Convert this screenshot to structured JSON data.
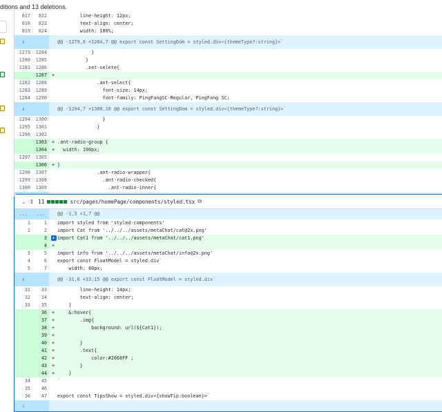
{
  "header": {
    "summary": "ditions and 13 deletions."
  },
  "file1": {
    "rows": [
      {
        "t": "ctx",
        "o": "817",
        "n": "822",
        "c": "        line-height: 12px;"
      },
      {
        "t": "ctx",
        "o": "818",
        "n": "823",
        "c": "        text-align: center;"
      },
      {
        "t": "ctx",
        "o": "819",
        "n": "824",
        "c": "        width: 100%;"
      },
      {
        "t": "hunk",
        "c": "@@ -1279,6 +1284,7 @@ export const SettingDom = styled.div<{themeType?:string}>`"
      },
      {
        "t": "ctx",
        "o": "1279",
        "n": "1284",
        "c": "            }"
      },
      {
        "t": "ctx",
        "o": "1280",
        "n": "1285",
        "c": "          }"
      },
      {
        "t": "ctx",
        "o": "1281",
        "n": "1286",
        "c": "          .set-selete{"
      },
      {
        "t": "add",
        "o": "",
        "n": "1287",
        "c": ""
      },
      {
        "t": "ctx",
        "o": "1282",
        "n": "1288",
        "c": "              .ant-select{"
      },
      {
        "t": "ctx",
        "o": "1283",
        "n": "1289",
        "c": "                font-size: 14px;"
      },
      {
        "t": "ctx",
        "o": "1284",
        "n": "1290",
        "c": "                font-family: PingFangSC-Regular, PingFang SC;"
      },
      {
        "t": "hunk",
        "c": "@@ -1294,7 +1300,10 @@ export const SettingDom = styled.div<{themeType?:string}>`"
      },
      {
        "t": "ctx",
        "o": "1294",
        "n": "1300",
        "c": "                }"
      },
      {
        "t": "ctx",
        "o": "1295",
        "n": "1301",
        "c": "              }"
      },
      {
        "t": "ctx",
        "o": "1296",
        "n": "1302",
        "c": ""
      },
      {
        "t": "add",
        "o": "",
        "n": "1303",
        "c": ".ant-radio-group {"
      },
      {
        "t": "add",
        "o": "",
        "n": "1304",
        "c": "  width: 190px;"
      },
      {
        "t": "ctx",
        "o": "1297",
        "n": "1305",
        "c": ""
      },
      {
        "t": "add",
        "o": "",
        "n": "1306",
        "c": "}"
      },
      {
        "t": "ctx",
        "o": "1298",
        "n": "1307",
        "c": "              .ant-radio-wrapper{"
      },
      {
        "t": "ctx",
        "o": "1299",
        "n": "1308",
        "c": "                .ant-radio-checked{"
      },
      {
        "t": "ctx",
        "o": "1300",
        "n": "1309",
        "c": "                  .ant-radio-inner{"
      }
    ]
  },
  "file2": {
    "count": "11",
    "path": "src/pages/homePage/components/styled.tsx",
    "dots_left": "...",
    "dots_right": "...",
    "first_hunk": "@@ -1,5 +1,7 @@",
    "rows": [
      {
        "t": "ctx",
        "o": "1",
        "n": "1",
        "c": "import styled from 'styled-components'"
      },
      {
        "t": "ctx",
        "o": "2",
        "n": "2",
        "c": "import Cat from '../../../assets/metaChat/cat@2x.png'"
      },
      {
        "t": "add",
        "o": "",
        "n": "3",
        "c": "import Cat1 from '../../../assets/metaChat/cat1.png'",
        "btn": true
      },
      {
        "t": "add",
        "o": "",
        "n": "4",
        "c": ""
      },
      {
        "t": "ctx",
        "o": "3",
        "n": "5",
        "c": "import info from '../../../assets/metaChat/info@2x.png'"
      },
      {
        "t": "ctx",
        "o": "4",
        "n": "6",
        "c": "export const FloatModel = styled.div`"
      },
      {
        "t": "ctx",
        "o": "5",
        "n": "7",
        "c": "    width: 80px;"
      },
      {
        "t": "hunk",
        "c": "@@ -31,6 +33,15 @@ export const FloatModel = styled.div`"
      },
      {
        "t": "ctx",
        "o": "31",
        "n": "33",
        "c": "        line-height: 14px;"
      },
      {
        "t": "ctx",
        "o": "32",
        "n": "34",
        "c": "        text-align: center;"
      },
      {
        "t": "ctx",
        "o": "33",
        "n": "35",
        "c": "    }"
      },
      {
        "t": "add",
        "o": "",
        "n": "36",
        "c": "    &:hover{"
      },
      {
        "t": "add",
        "o": "",
        "n": "37",
        "c": "        .img{"
      },
      {
        "t": "add",
        "o": "",
        "n": "38",
        "c": "            background: url(${Cat1});"
      },
      {
        "t": "add",
        "o": "",
        "n": "39",
        "c": ""
      },
      {
        "t": "add",
        "o": "",
        "n": "40",
        "c": "        }"
      },
      {
        "t": "add",
        "o": "",
        "n": "41",
        "c": "        .text{"
      },
      {
        "t": "add",
        "o": "",
        "n": "42",
        "c": "            color:#2668FF ;"
      },
      {
        "t": "add",
        "o": "",
        "n": "43",
        "c": "        }"
      },
      {
        "t": "add",
        "o": "",
        "n": "44",
        "c": "    }"
      },
      {
        "t": "ctx",
        "o": "34",
        "n": "45",
        "c": "`"
      },
      {
        "t": "ctx",
        "o": "35",
        "n": "46",
        "c": ""
      },
      {
        "t": "ctx",
        "o": "36",
        "n": "47",
        "c": "export const TipsShow = styled.div<{showTip:boolean}>`"
      }
    ]
  },
  "icons": {
    "expand": "expand-icon",
    "chevron": "chevron-down-icon",
    "copy": "copy-icon",
    "add_comment": "plus-icon"
  },
  "colors": {
    "add_bg": "#e6ffec",
    "add_num_bg": "#ccffd8",
    "hunk_bg": "#ddf4ff",
    "accent": "#0969da",
    "diffstat": "#1a7f37"
  }
}
